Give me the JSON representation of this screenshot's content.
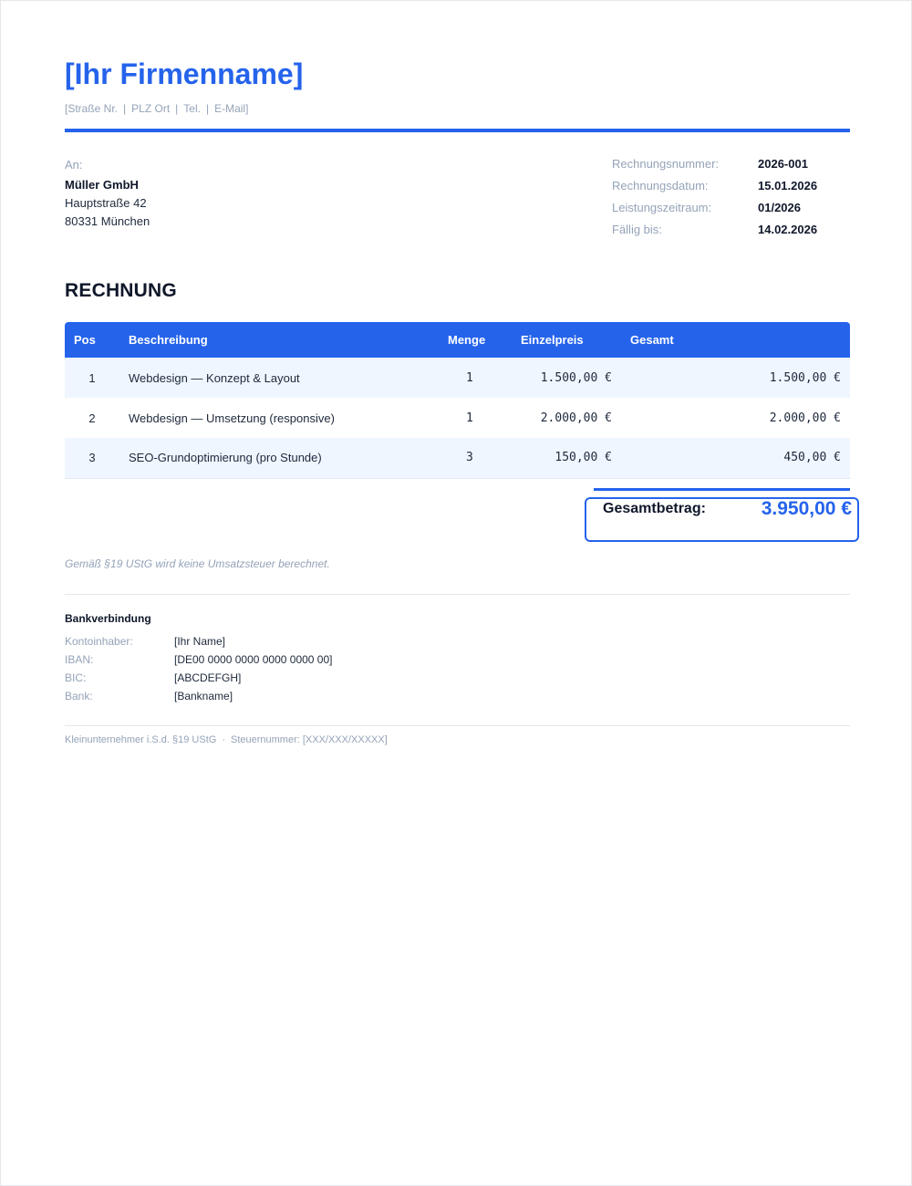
{
  "header": {
    "company_name": "[Ihr Firmenname]",
    "address_parts": [
      "[Straße Nr.",
      "PLZ Ort",
      "Tel.",
      "E-Mail]"
    ],
    "separator": "|",
    "accent_color": "#2563eb"
  },
  "recipient": {
    "label": "An:",
    "name": "Müller GmbH",
    "street": "Hauptstraße 42",
    "city": "80331 München"
  },
  "meta": [
    {
      "label": "Rechnungsnummer:",
      "value": "2026-001"
    },
    {
      "label": "Rechnungsdatum:",
      "value": "15.01.2026"
    },
    {
      "label": "Leistungszeitraum:",
      "value": "01/2026"
    },
    {
      "label": "Fällig bis:",
      "value": "14.02.2026"
    }
  ],
  "document_title": "RECHNUNG",
  "table": {
    "headers": {
      "pos": "Pos",
      "description": "Beschreibung",
      "quantity": "Menge",
      "unit_price": "Einzelpreis",
      "total": "Gesamt"
    },
    "rows": [
      {
        "pos": "1",
        "description": "Webdesign — Konzept & Layout",
        "quantity": "1",
        "unit_price": "1.500,00 €",
        "total": "1.500,00 €"
      },
      {
        "pos": "2",
        "description": "Webdesign — Umsetzung (responsive)",
        "quantity": "1",
        "unit_price": "2.000,00 €",
        "total": "2.000,00 €"
      },
      {
        "pos": "3",
        "description": "SEO-Grundoptimierung (pro Stunde)",
        "quantity": "3",
        "unit_price": "150,00 €",
        "total": "450,00 €"
      }
    ]
  },
  "summary": {
    "total_label": "Gesamtbetrag:",
    "total_value": "3.950,00 €"
  },
  "tax_note": "Gemäß §19 UStG wird keine Umsatzsteuer berechnet.",
  "bank": {
    "title": "Bankverbindung",
    "rows": [
      {
        "label": "Kontoinhaber:",
        "value": "[Ihr Name]"
      },
      {
        "label": "IBAN:",
        "value": "[DE00 0000 0000 0000 0000 00]"
      },
      {
        "label": "BIC:",
        "value": "[ABCDEFGH]"
      },
      {
        "label": "Bank:",
        "value": "[Bankname]"
      }
    ]
  },
  "footer": {
    "left": "Kleinunternehmer i.S.d. §19 UStG",
    "dot": "·",
    "right": "Steuernummer: [XXX/XXX/XXXXX]"
  }
}
